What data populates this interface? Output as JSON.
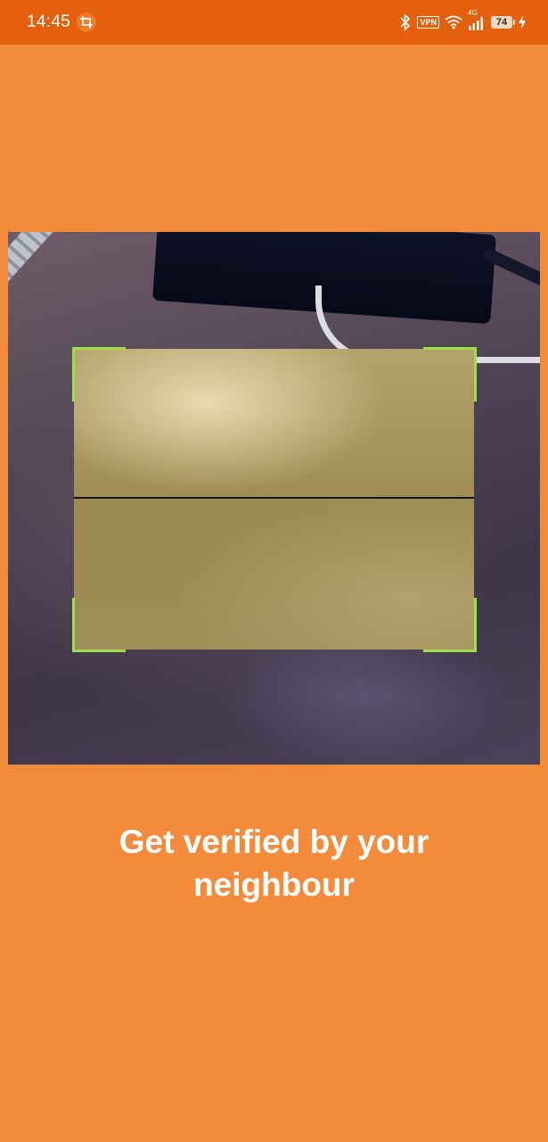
{
  "status_bar": {
    "time": "14:45",
    "vpn_label": "VPN",
    "network_label": "4G",
    "battery_level": "74",
    "icons": [
      "crop-icon",
      "bluetooth-icon",
      "vpn-icon",
      "wifi-icon",
      "signal-icon",
      "battery-icon",
      "charging-icon"
    ]
  },
  "scanner": {
    "frame_color": "#9EE04A"
  },
  "headline": {
    "text": "Get verified by your neighbour"
  },
  "colors": {
    "background": "#F28C3C",
    "status_bar": "#E4600C",
    "text": "#FFFFFF"
  }
}
